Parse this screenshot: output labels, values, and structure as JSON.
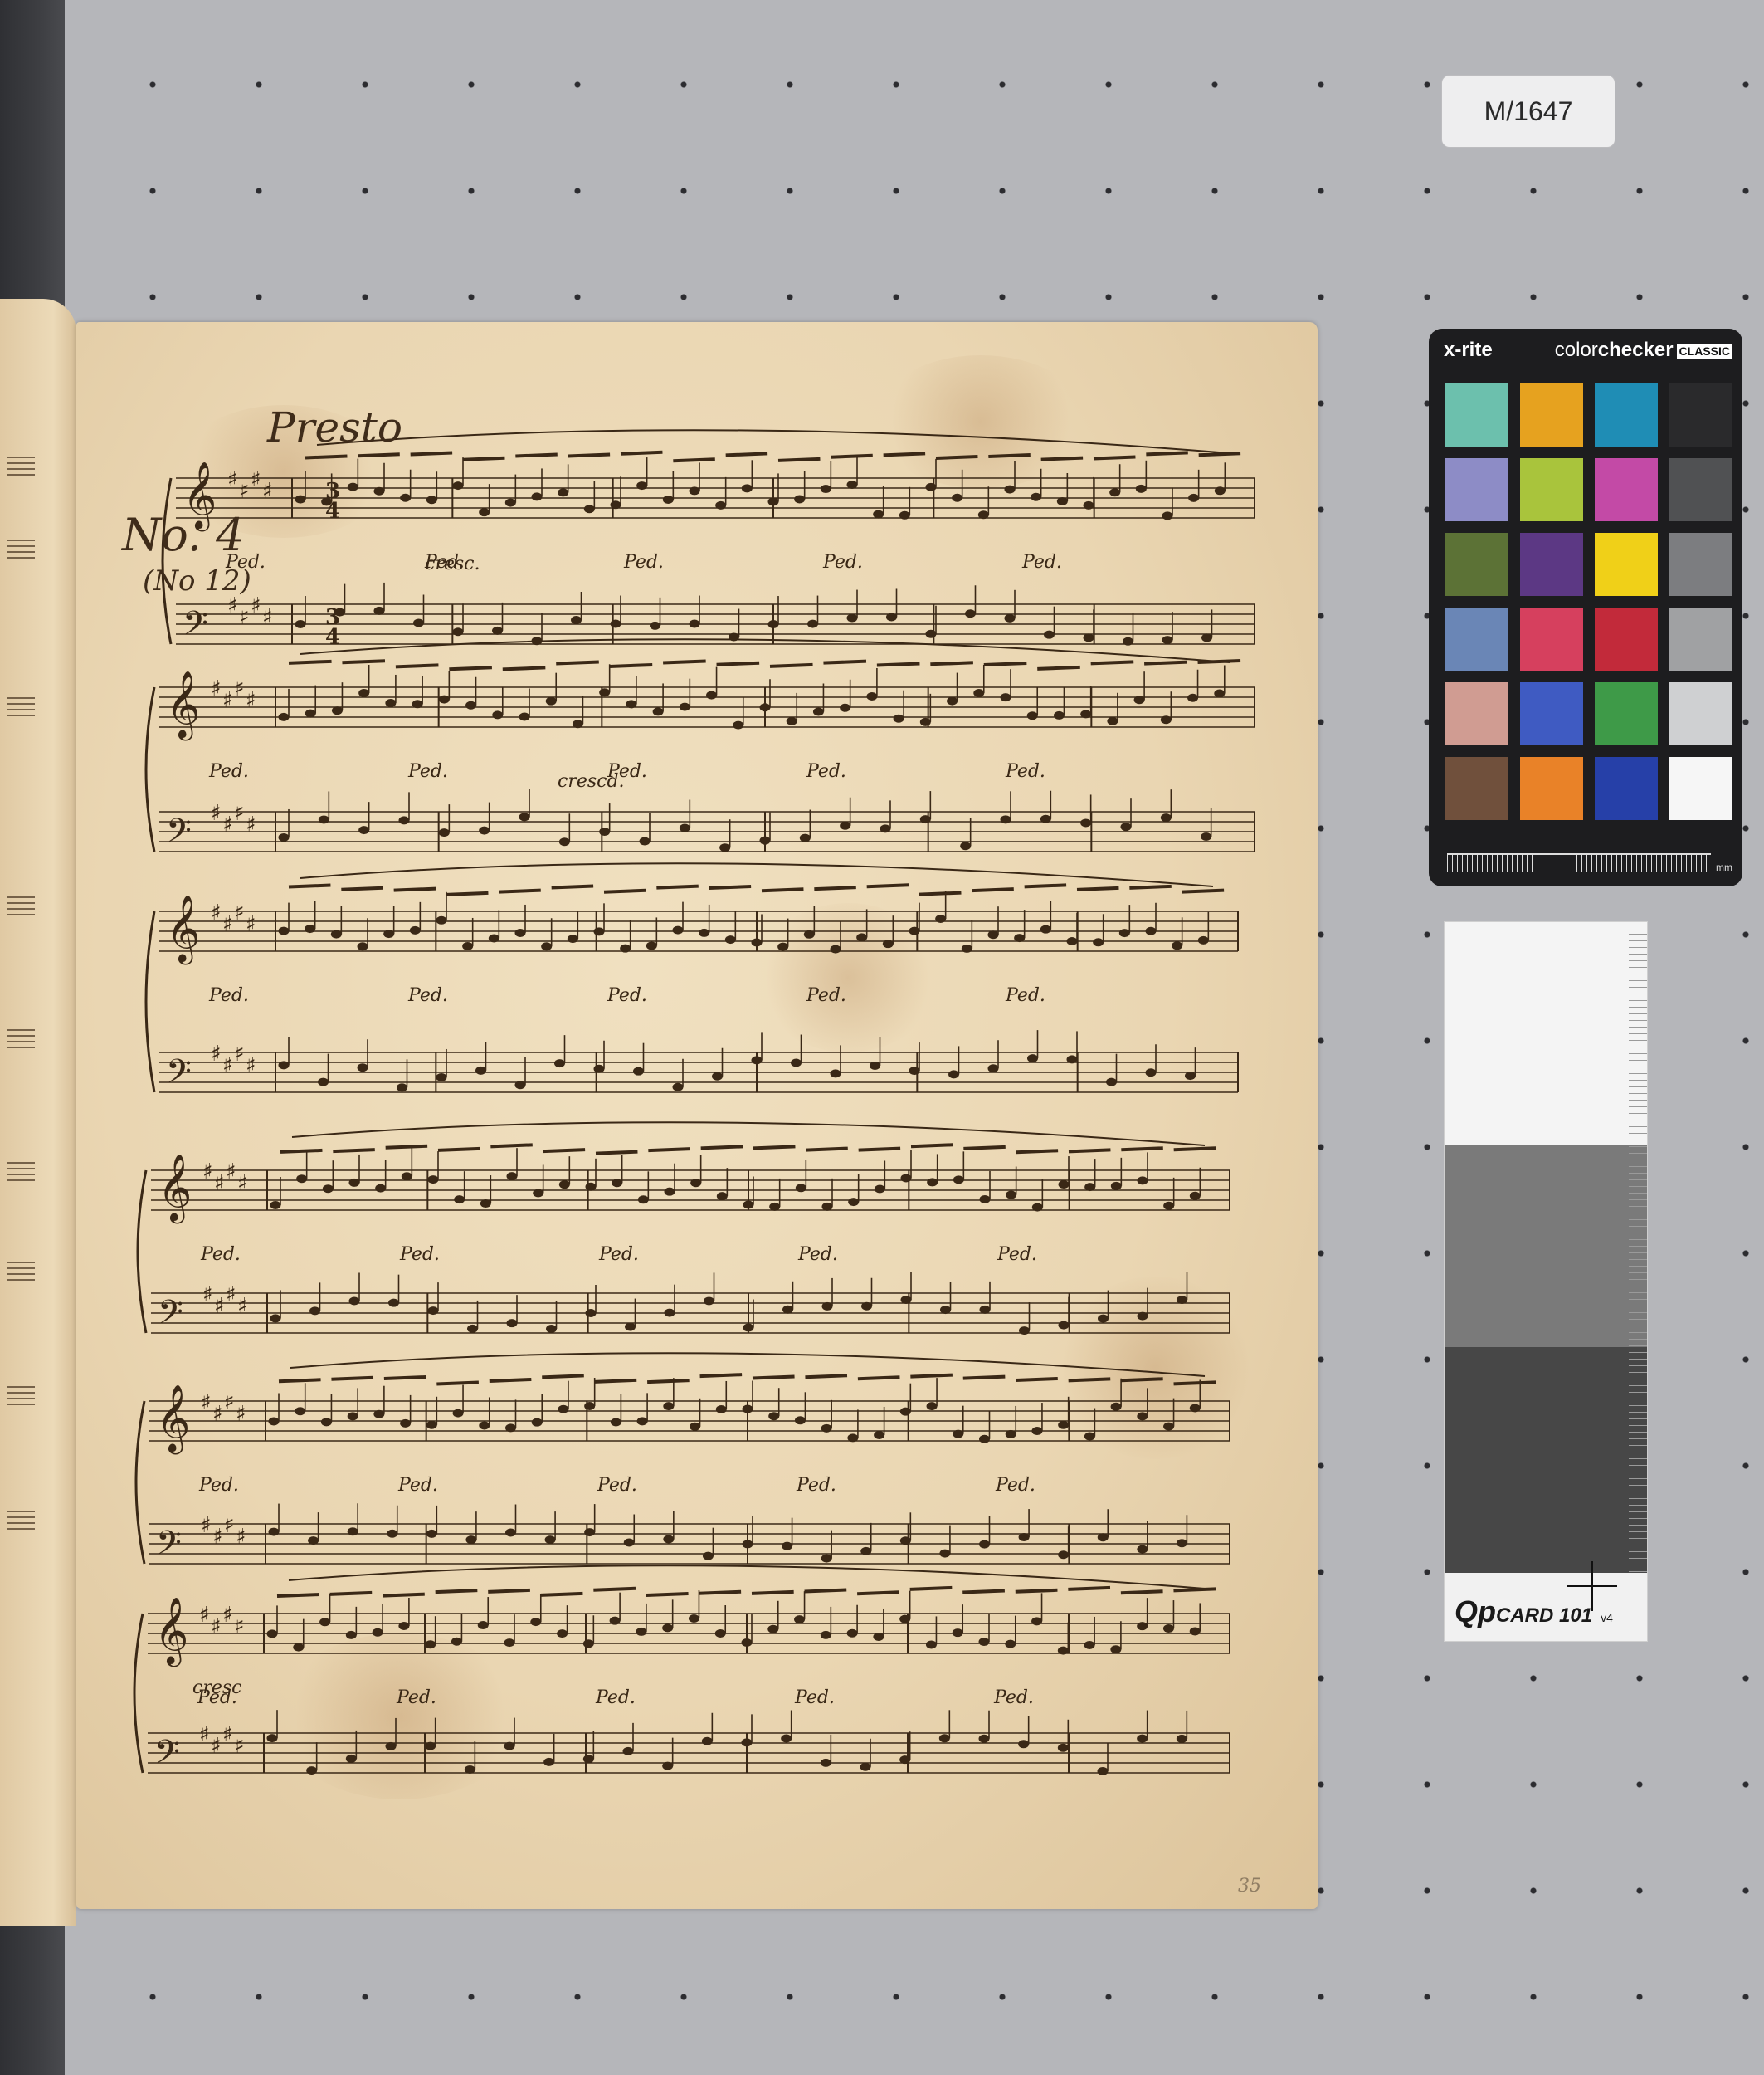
{
  "label_tag": "M/1647",
  "score": {
    "tempo": "Presto",
    "piece_number": "No. 4",
    "piece_sub": "(No 12)",
    "folio": "35",
    "key_signature_sharps": 4,
    "time_signature": "3/4",
    "systems": 6,
    "pedal_mark": "Ped.",
    "dynamic_marks": [
      "cresc.",
      "crescd.",
      "cresc"
    ]
  },
  "colorchecker": {
    "brand": "x-rite",
    "title_light": "color",
    "title_bold": "checker",
    "classic": "CLASSIC",
    "unit": "mm",
    "patches": [
      "#6cc0ad",
      "#e6a21f",
      "#1f8db5",
      "#2a2a2c",
      "#8d8cc6",
      "#a9c43c",
      "#c34aa6",
      "#505153",
      "#5c7236",
      "#5c3884",
      "#f0d018",
      "#7c7d80",
      "#6a86b6",
      "#d6405e",
      "#c22a3a",
      "#a0a1a3",
      "#d09c92",
      "#3f5bc2",
      "#3e9a48",
      "#cfd0d2",
      "#70503c",
      "#e98228",
      "#2640a8",
      "#f6f6f6"
    ]
  },
  "graycard": {
    "logo": "Qp",
    "logo_sub": "CARD 101",
    "version": "v4",
    "steps": [
      "#f4f4f4",
      "#7a7a7a",
      "#474747"
    ]
  }
}
